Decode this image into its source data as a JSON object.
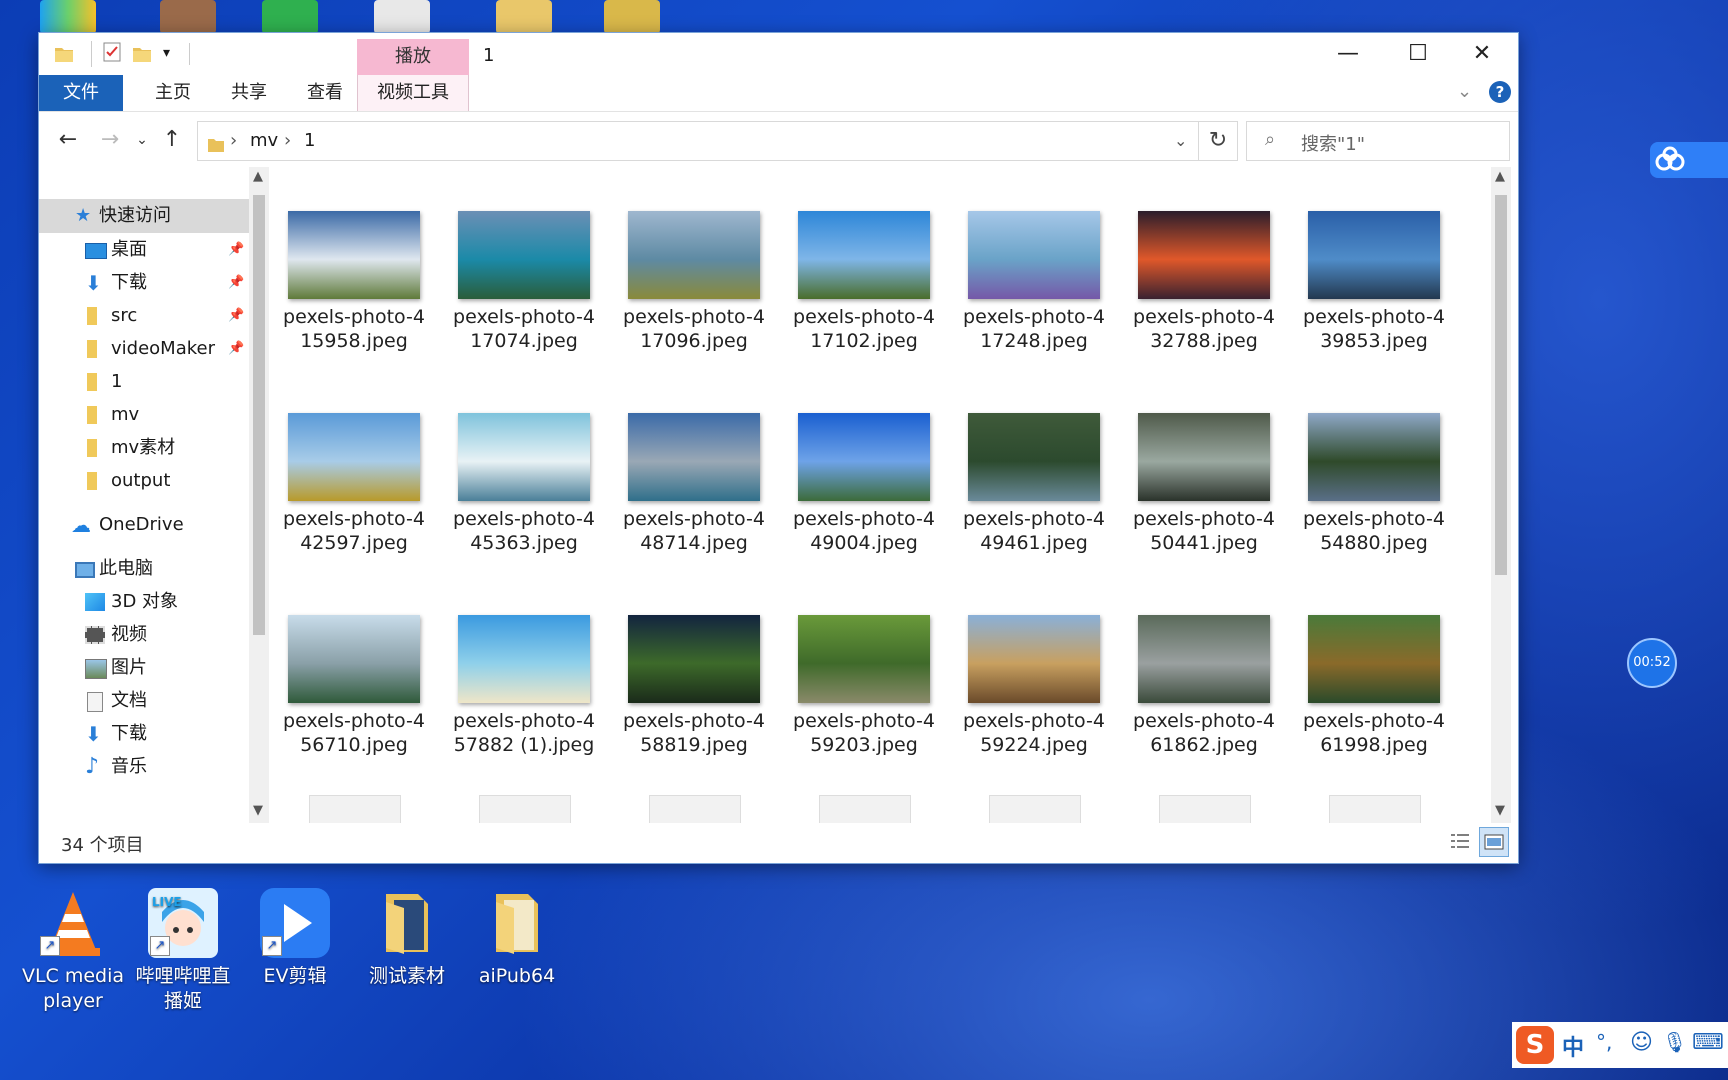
{
  "window": {
    "title": "1",
    "contextual_tab": "播放",
    "ribbon_tabs": [
      "文件",
      "主页",
      "共享",
      "查看",
      "视频工具"
    ],
    "controls": {
      "minimize": "—",
      "maximize": "☐",
      "close": "✕"
    }
  },
  "address": {
    "path": [
      "mv",
      "1"
    ],
    "search_placeholder": "搜索\"1\""
  },
  "nav_pane": {
    "quick_access": "快速访问",
    "pinned": [
      "桌面",
      "下载",
      "src",
      "videoMaker"
    ],
    "folders": [
      "1",
      "mv",
      "mv素材",
      "output"
    ],
    "onedrive": "OneDrive",
    "this_pc": "此电脑",
    "pc_items": [
      "3D 对象",
      "视频",
      "图片",
      "文档",
      "下载",
      "音乐"
    ]
  },
  "files": [
    {
      "line1": "pexels-photo-4",
      "line2": "15958.jpeg",
      "colors": [
        "#3b6aa6",
        "#dfe7ef",
        "#5f7a3a"
      ]
    },
    {
      "line1": "pexels-photo-4",
      "line2": "17074.jpeg",
      "colors": [
        "#6b8fb5",
        "#1b8aa8",
        "#2a5d3a"
      ]
    },
    {
      "line1": "pexels-photo-4",
      "line2": "17096.jpeg",
      "colors": [
        "#9fb7cf",
        "#5e8aa3",
        "#8a8a3a"
      ]
    },
    {
      "line1": "pexels-photo-4",
      "line2": "17102.jpeg",
      "colors": [
        "#2d86d8",
        "#7fb6e8",
        "#4a6d2b"
      ]
    },
    {
      "line1": "pexels-photo-4",
      "line2": "17248.jpeg",
      "colors": [
        "#a6c7e8",
        "#6aa3c8",
        "#7558a8"
      ]
    },
    {
      "line1": "pexels-photo-4",
      "line2": "32788.jpeg",
      "colors": [
        "#2b1d2b",
        "#e0582a",
        "#3a2230"
      ]
    },
    {
      "line1": "pexels-photo-4",
      "line2": "39853.jpeg",
      "colors": [
        "#2a5fa8",
        "#4f8cc8",
        "#23384f"
      ]
    },
    {
      "line1": "pexels-photo-4",
      "line2": "42597.jpeg",
      "colors": [
        "#5a9ad8",
        "#a8cce8",
        "#b89a2a"
      ]
    },
    {
      "line1": "pexels-photo-4",
      "line2": "45363.jpeg",
      "colors": [
        "#7fc3dc",
        "#e8f2f5",
        "#4a7f98"
      ]
    },
    {
      "line1": "pexels-photo-4",
      "line2": "48714.jpeg",
      "colors": [
        "#3a6aa8",
        "#9aa8b5",
        "#2f6f8a"
      ]
    },
    {
      "line1": "pexels-photo-4",
      "line2": "49004.jpeg",
      "colors": [
        "#1a5fd0",
        "#6ea3e8",
        "#3c6b3a"
      ]
    },
    {
      "line1": "pexels-photo-4",
      "line2": "49461.jpeg",
      "colors": [
        "#3f5a3a",
        "#2c4a2e",
        "#6a8a9a"
      ]
    },
    {
      "line1": "pexels-photo-4",
      "line2": "50441.jpeg",
      "colors": [
        "#4f5a4a",
        "#9aa8a0",
        "#2a322a"
      ]
    },
    {
      "line1": "pexels-photo-4",
      "line2": "54880.jpeg",
      "colors": [
        "#8fa8c8",
        "#2f4a2a",
        "#5a6f88"
      ]
    },
    {
      "line1": "pexels-photo-4",
      "line2": "56710.jpeg",
      "colors": [
        "#c8dcea",
        "#8aa0a8",
        "#2f5a3a"
      ]
    },
    {
      "line1": "pexels-photo-4",
      "line2": "57882 (1).jpeg",
      "colors": [
        "#3b9ae0",
        "#8fd0ea",
        "#efe6c8"
      ]
    },
    {
      "line1": "pexels-photo-4",
      "line2": "58819.jpeg",
      "colors": [
        "#12243f",
        "#3d6a2a",
        "#1a2a1a"
      ]
    },
    {
      "line1": "pexels-photo-4",
      "line2": "59203.jpeg",
      "colors": [
        "#6a9a3a",
        "#3f6a2a",
        "#8a8a6a"
      ]
    },
    {
      "line1": "pexels-photo-4",
      "line2": "59224.jpeg",
      "colors": [
        "#8ab0d8",
        "#c8a060",
        "#6a4a2a"
      ]
    },
    {
      "line1": "pexels-photo-4",
      "line2": "61862.jpeg",
      "colors": [
        "#5a6a5a",
        "#9aa0a0",
        "#3a4a3a"
      ]
    },
    {
      "line1": "pexels-photo-4",
      "line2": "61998.jpeg",
      "colors": [
        "#4a7a3a",
        "#8a6a2a",
        "#2a4a2a"
      ]
    }
  ],
  "status": {
    "count_text": "34 个项目"
  },
  "desktop_icons": [
    {
      "label": "VLC media player"
    },
    {
      "label": "哔哩哔哩直播姬",
      "badge": "LIVE"
    },
    {
      "label": "EV剪辑"
    },
    {
      "label": "测试素材"
    },
    {
      "label": "aiPub64"
    }
  ],
  "overlay": {
    "timer": "00:52"
  },
  "tray": {
    "ime_logo": "S",
    "ime_mode": "中",
    "punct": "°,"
  },
  "colors": {
    "accent": "#1b62b8",
    "contextual_tab": "#f6b8d1",
    "desktop": "#1550d0"
  }
}
